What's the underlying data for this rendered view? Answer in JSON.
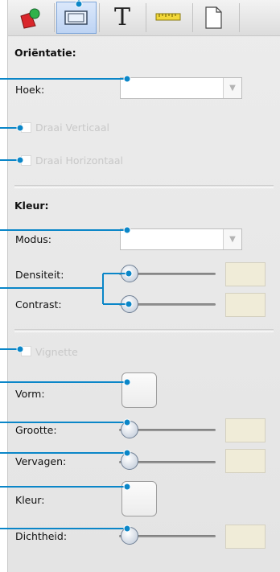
{
  "toolbar": {
    "buttons": [
      {
        "icon": "image-color-icon",
        "active": false
      },
      {
        "icon": "frame-icon",
        "active": true
      },
      {
        "icon": "T"
      },
      {
        "icon": "ruler-icon",
        "active": false
      },
      {
        "icon": "page-icon",
        "active": false
      }
    ]
  },
  "orientation": {
    "header": "Oriëntatie:",
    "angle_label": "Hoek:",
    "angle_value": "",
    "flip_vertical_label": "Draai Verticaal",
    "flip_horizontal_label": "Draai Horizontaal"
  },
  "color": {
    "header": "Kleur:",
    "mode_label": "Modus:",
    "mode_value": "",
    "density_label": "Densiteit:",
    "density_value": "",
    "contrast_label": "Contrast:",
    "contrast_value": ""
  },
  "vignette": {
    "label": "Vignette",
    "shape_label": "Vorm:",
    "size_label": "Grootte:",
    "size_value": "",
    "fade_label": "Vervagen:",
    "fade_value": "",
    "color_label": "Kleur:",
    "density_label": "Dichtheid:",
    "density_value": ""
  },
  "colors": {
    "callout": "#0a86c8",
    "disabled_text": "#c8c8c8",
    "value_box": "#f0ecd8"
  }
}
